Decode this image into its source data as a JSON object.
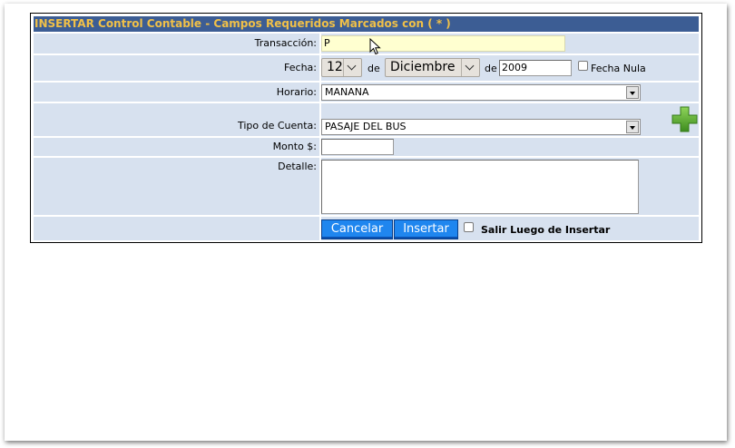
{
  "form": {
    "title": "INSERTAR Control Contable  -  Campos Requeridos Marcados con ( * )",
    "transaccion": {
      "label": "Transacción:",
      "value": "P"
    },
    "fecha": {
      "label": "Fecha:",
      "day": "12",
      "de1": "de",
      "month": "Diciembre",
      "de2": "de",
      "year": "2009",
      "nula_label": "Fecha Nula"
    },
    "horario": {
      "label": "Horario:",
      "value": "MANANA"
    },
    "tipo_cuenta": {
      "label": "Tipo de Cuenta:",
      "value": "PASAJE DEL BUS",
      "add_icon": "plus-icon"
    },
    "monto": {
      "label": "Monto $:",
      "value": ""
    },
    "detalle": {
      "label": "Detalle:",
      "value": ""
    },
    "buttons": {
      "cancelar": "Cancelar",
      "insertar": "Insertar"
    },
    "salir_label": "Salir Luego de Insertar"
  },
  "colors": {
    "title_bg": "#3c5d94",
    "title_text": "#f0c048",
    "row_bg": "#d7e1ef",
    "button_bg": "#1f86ef",
    "highlight_input": "#ffffd0",
    "plus_icon": "#5cae2e"
  }
}
